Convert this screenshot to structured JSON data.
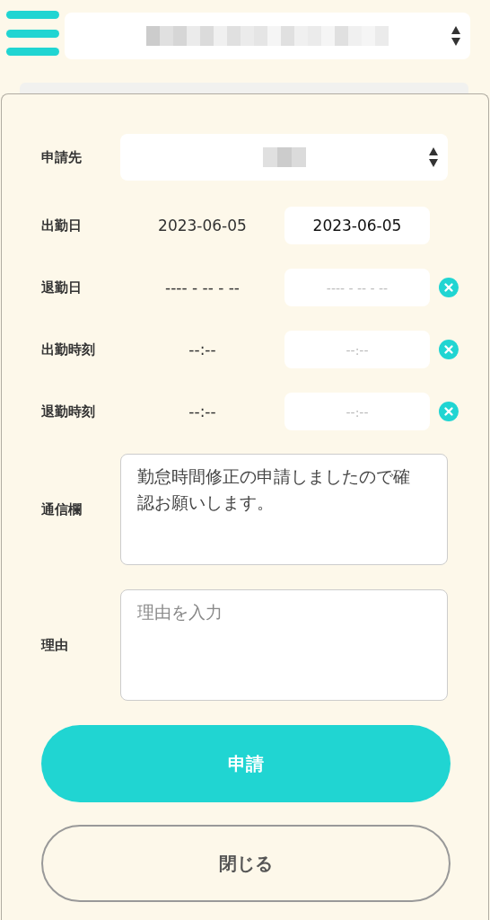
{
  "header": {
    "company_select": {
      "redacted": true
    }
  },
  "form": {
    "rows": [
      {
        "kind": "select",
        "label": "申請先",
        "redacted": true
      },
      {
        "kind": "pair",
        "label": "出勤日",
        "current": "2023-06-05",
        "value": "2023-06-05",
        "clearable": false
      },
      {
        "kind": "pair",
        "label": "退勤日",
        "current": "---- - -- - --",
        "placeholder": "---- - -- - --",
        "clearable": true
      },
      {
        "kind": "pair",
        "label": "出勤時刻",
        "current": "--:--",
        "placeholder": "--:--",
        "clearable": true
      },
      {
        "kind": "pair",
        "label": "退勤時刻",
        "current": "--:--",
        "placeholder": "--:--",
        "clearable": true
      },
      {
        "kind": "textarea",
        "label": "通信欄",
        "value": "勤怠時間修正の申請しましたので確認お願いします。"
      },
      {
        "kind": "textarea",
        "label": "理由",
        "placeholder": "理由を入力"
      }
    ]
  },
  "buttons": [
    {
      "kind": "primary",
      "label": "申請"
    },
    {
      "kind": "secondary",
      "label": "閉じる"
    }
  ]
}
